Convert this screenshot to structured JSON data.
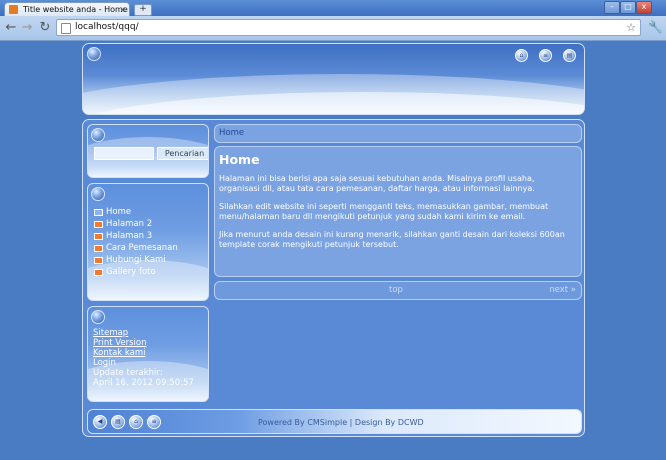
{
  "browser": {
    "tab_title": "Title website anda - Home",
    "tab_close": "x",
    "new_tab": "+",
    "url": "localhost/qqq/",
    "back": "←",
    "forward": "→",
    "reload": "↻",
    "star": "☆",
    "wrench": "🔧",
    "win_min": "–",
    "win_max": "□",
    "win_close": "x"
  },
  "header": {
    "icons": [
      "home-icon",
      "sitemap-icon",
      "print-icon"
    ]
  },
  "search": {
    "button_label": "Pencarian",
    "value": ""
  },
  "menu": {
    "items": [
      "Home",
      "Halaman 2",
      "Halaman 3",
      "Cara Pemesanan",
      "Hubungi Kami",
      "Gallery foto"
    ]
  },
  "links": {
    "sitemap": "Sitemap",
    "print": "Print Version",
    "contact": "Kontak kami",
    "login": "Login",
    "update_label": "Update terakhir:",
    "update_date": "April 16. 2012 09:50:57"
  },
  "main": {
    "breadcrumb": "Home",
    "title": "Home",
    "paragraphs": [
      "Halaman ini bisa berisi apa saja sesuai kebutuhan anda. Misalnya profil usaha, organisasi dll, atau tata cara pemesanan, daftar harga, atau informasi lainnya.",
      "Silahkan edit website ini seperti mengganti teks, memasukkan gambar, membuat menu/halaman baru dll mengikuti petunjuk yang sudah kami kirim ke email.",
      "Jika menurut anda desain ini kurang menarik, silahkan ganti desain dari koleksi 600an template corak mengikuti petunjuk tersebut."
    ],
    "pager_top": "top",
    "pager_next": "next »"
  },
  "footer": {
    "text": "Powered By CMSimple  |  Design By DCWD"
  }
}
